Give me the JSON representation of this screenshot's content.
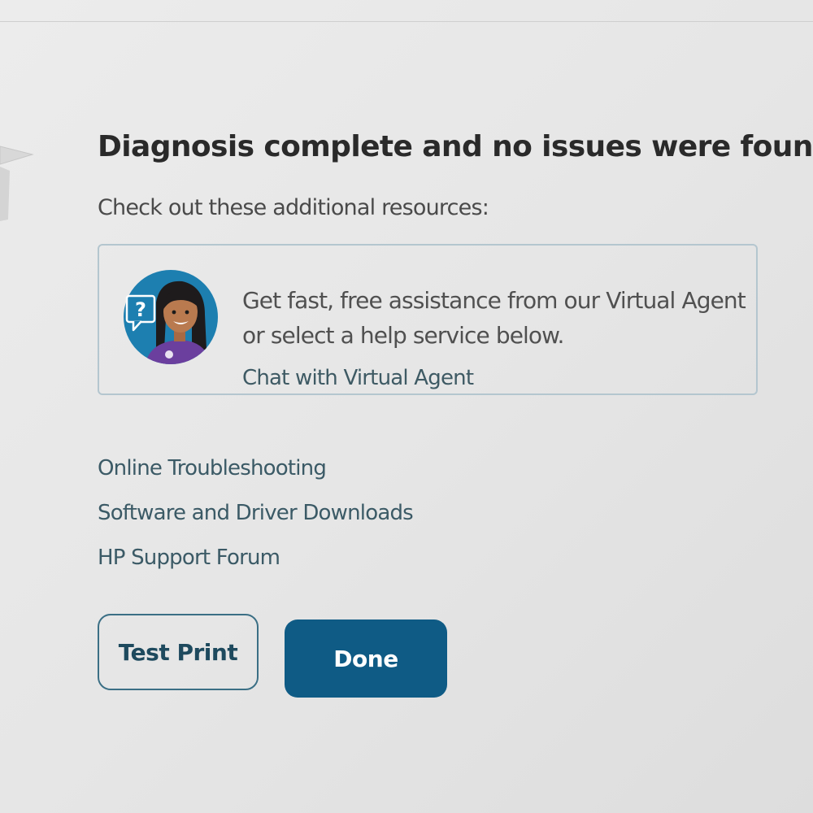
{
  "dialog": {
    "title": "Diagnosis complete and no issues were found.",
    "subtitle": "Check out these additional resources:"
  },
  "virtual_agent": {
    "line1": "Get fast, free assistance from our Virtual Agent",
    "line2": "or select a help service below.",
    "link_label": "Chat with Virtual Agent",
    "avatar_icon": "virtual-agent-avatar"
  },
  "resources": [
    {
      "label": "Online Troubleshooting"
    },
    {
      "label": "Software and Driver Downloads"
    },
    {
      "label": "HP Support Forum"
    }
  ],
  "buttons": {
    "test_print": "Test Print",
    "done": "Done"
  },
  "colors": {
    "primary_button": "#0f5b85",
    "link": "#3b5a66",
    "card_border": "#b4c6cf"
  }
}
